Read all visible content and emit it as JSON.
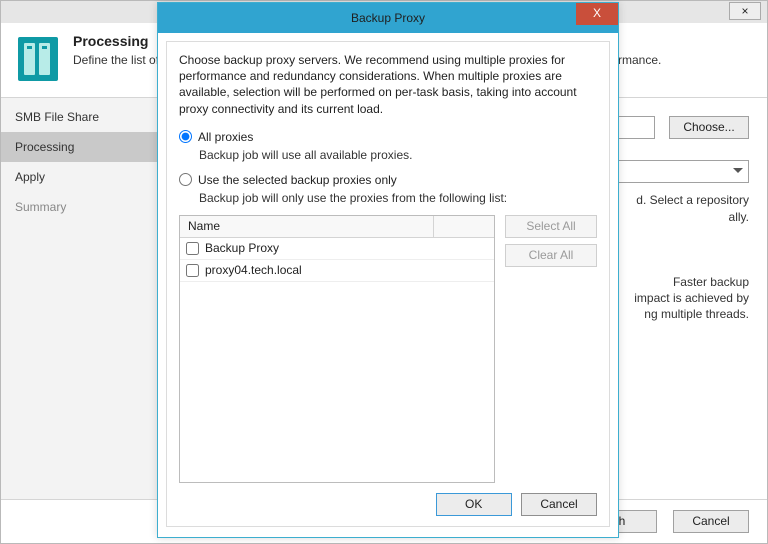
{
  "colors": {
    "accent": "#30a4d0",
    "close_bg": "#c94f3b"
  },
  "wizard": {
    "close_x": "×",
    "header_title": "Processing",
    "header_desc": "Define the list of backup proxies and repositories and how to read the metadata for faster backup performance.",
    "nav": [
      {
        "label": "SMB File Share",
        "active": false,
        "faded": false
      },
      {
        "label": "Processing",
        "active": true,
        "faded": false
      },
      {
        "label": "Apply",
        "active": false,
        "faded": false
      },
      {
        "label": "Summary",
        "active": false,
        "faded": true
      }
    ],
    "choose_label": "Choose...",
    "info_right_lines": "d. Select a repository\nally.",
    "faster_lines": "Faster backup\nimpact is achieved by\nng multiple threads.",
    "footer_finish": "sh",
    "footer_cancel": "Cancel"
  },
  "modal": {
    "title": "Backup Proxy",
    "close_x": "X",
    "description": "Choose backup proxy servers. We recommend using multiple proxies for performance and redundancy considerations. When multiple proxies are available, selection will be performed on per-task basis, taking into account proxy connectivity and its current load.",
    "opt_all_label": "All proxies",
    "opt_all_hint": "Backup job will use all available proxies.",
    "opt_sel_label": "Use the selected backup proxies only",
    "opt_sel_hint": "Backup job will only use the proxies from the following list:",
    "list_header": "Name",
    "select_all": "Select All",
    "clear_all": "Clear All",
    "proxies": [
      {
        "name": "Backup Proxy",
        "checked": false
      },
      {
        "name": "proxy04.tech.local",
        "checked": false
      }
    ],
    "ok_label": "OK",
    "cancel_label": "Cancel",
    "selected_option": "all"
  }
}
